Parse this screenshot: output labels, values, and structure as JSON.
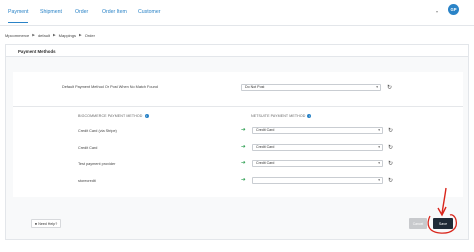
{
  "nav": {
    "tabs": [
      "Payment",
      "Shipment",
      "Order",
      "Order Item",
      "Customer"
    ],
    "user_initials": "GP"
  },
  "breadcrumb": [
    "Mpcommerce",
    "default",
    "Mappings",
    "Order"
  ],
  "panel": {
    "title": "Payment Methods",
    "default_label": "Default Payment Method Or Post When No Match Found",
    "default_value": "Do Not Post"
  },
  "columns": {
    "left": "BIGCOMMERCE PAYMENT METHOD",
    "right": "NETSUITE PAYMENT METHOD"
  },
  "rows": [
    {
      "source": "Credit Card (via Stripe)",
      "target": "Credit Card"
    },
    {
      "source": "Credit Card",
      "target": "Credit Card"
    },
    {
      "source": "Test payment provider",
      "target": "Credit Card"
    },
    {
      "source": "storecredit",
      "target": ""
    }
  ],
  "footer": {
    "help_label": "Need Help?",
    "cancel_label": "Cancel",
    "save_label": "Save"
  },
  "colors": {
    "accent": "#2a83c7",
    "save_bg": "#1f2a36",
    "arrow_green": "#2a9d4f",
    "annotation_red": "#d9261c"
  }
}
